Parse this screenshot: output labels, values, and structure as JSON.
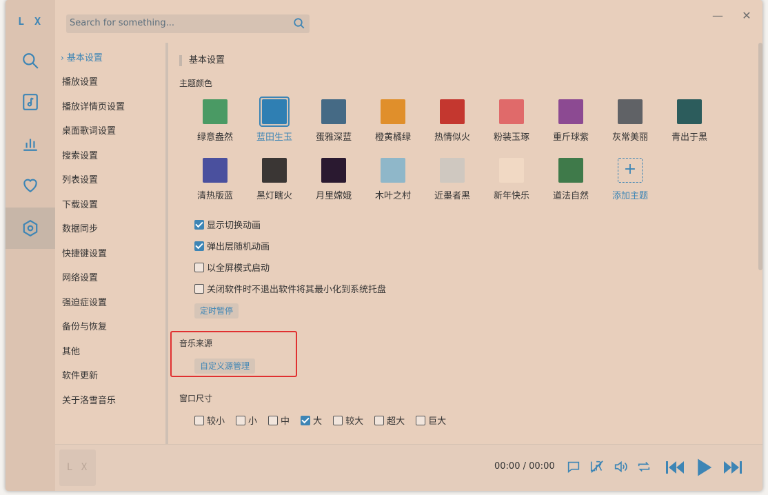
{
  "app": {
    "logo": "L X"
  },
  "search": {
    "placeholder": "Search for something..."
  },
  "window": {
    "minimize": "—",
    "close": "✕"
  },
  "nav": {
    "chevron": "›",
    "items": [
      "基本设置",
      "播放设置",
      "播放详情页设置",
      "桌面歌词设置",
      "搜索设置",
      "列表设置",
      "下载设置",
      "数据同步",
      "快捷键设置",
      "网络设置",
      "强迫症设置",
      "备份与恢复",
      "其他",
      "软件更新",
      "关于洛雪音乐"
    ]
  },
  "content": {
    "section_title": "基本设置",
    "theme_title": "主题颜色",
    "themes": [
      {
        "name": "绿意盎然",
        "color": "#4a9a64"
      },
      {
        "name": "蓝田生玉",
        "color": "#2f7fb3"
      },
      {
        "name": "蛋雅深蓝",
        "color": "#456a85"
      },
      {
        "name": "橙黄橘绿",
        "color": "#e08f2b"
      },
      {
        "name": "热情似火",
        "color": "#c4372f"
      },
      {
        "name": "粉装玉琢",
        "color": "#e06a6a"
      },
      {
        "name": "重斤球紫",
        "color": "#8c4a92"
      },
      {
        "name": "灰常美丽",
        "color": "#606266"
      },
      {
        "name": "青出于黑",
        "color": "#2c5c5c"
      },
      {
        "name": "清热版蓝",
        "color": "#4a509e"
      },
      {
        "name": "黑灯瞎火",
        "color": "#3a3634"
      },
      {
        "name": "月里嫦娥",
        "color": "#2a1930"
      },
      {
        "name": "木叶之村",
        "color": "#8fb7c9"
      },
      {
        "name": "近墨者黑",
        "color": "#cfc8c0"
      },
      {
        "name": "新年快乐",
        "color": "#f1d9c4"
      },
      {
        "name": "道法自然",
        "color": "#3f7a4a"
      },
      {
        "name": "添加主题",
        "color": "",
        "add_symbol": "+"
      }
    ],
    "options": [
      {
        "label": "显示切换动画",
        "checked": true
      },
      {
        "label": "弹出层随机动画",
        "checked": true
      },
      {
        "label": "以全屏模式启动",
        "checked": false
      },
      {
        "label": "关闭软件时不退出软件将其最小化到系统托盘",
        "checked": false
      }
    ],
    "timer_button": "定时暂停",
    "source_title": "音乐来源",
    "source_button": "自定义源管理",
    "size_title": "窗口尺寸",
    "sizes": [
      {
        "label": "较小",
        "checked": false
      },
      {
        "label": "小",
        "checked": false
      },
      {
        "label": "中",
        "checked": false
      },
      {
        "label": "大",
        "checked": true
      },
      {
        "label": "较大",
        "checked": false
      },
      {
        "label": "超大",
        "checked": false
      },
      {
        "label": "巨大",
        "checked": false
      }
    ],
    "highlight_color": "#e03030"
  },
  "player": {
    "cover_text": "L X",
    "current_time": "00:00",
    "separator": "/",
    "total_time": "00:00"
  },
  "colors": {
    "accent": "#3d85b5",
    "background": "#e8cfbc",
    "rail": "#dcc3b1"
  }
}
